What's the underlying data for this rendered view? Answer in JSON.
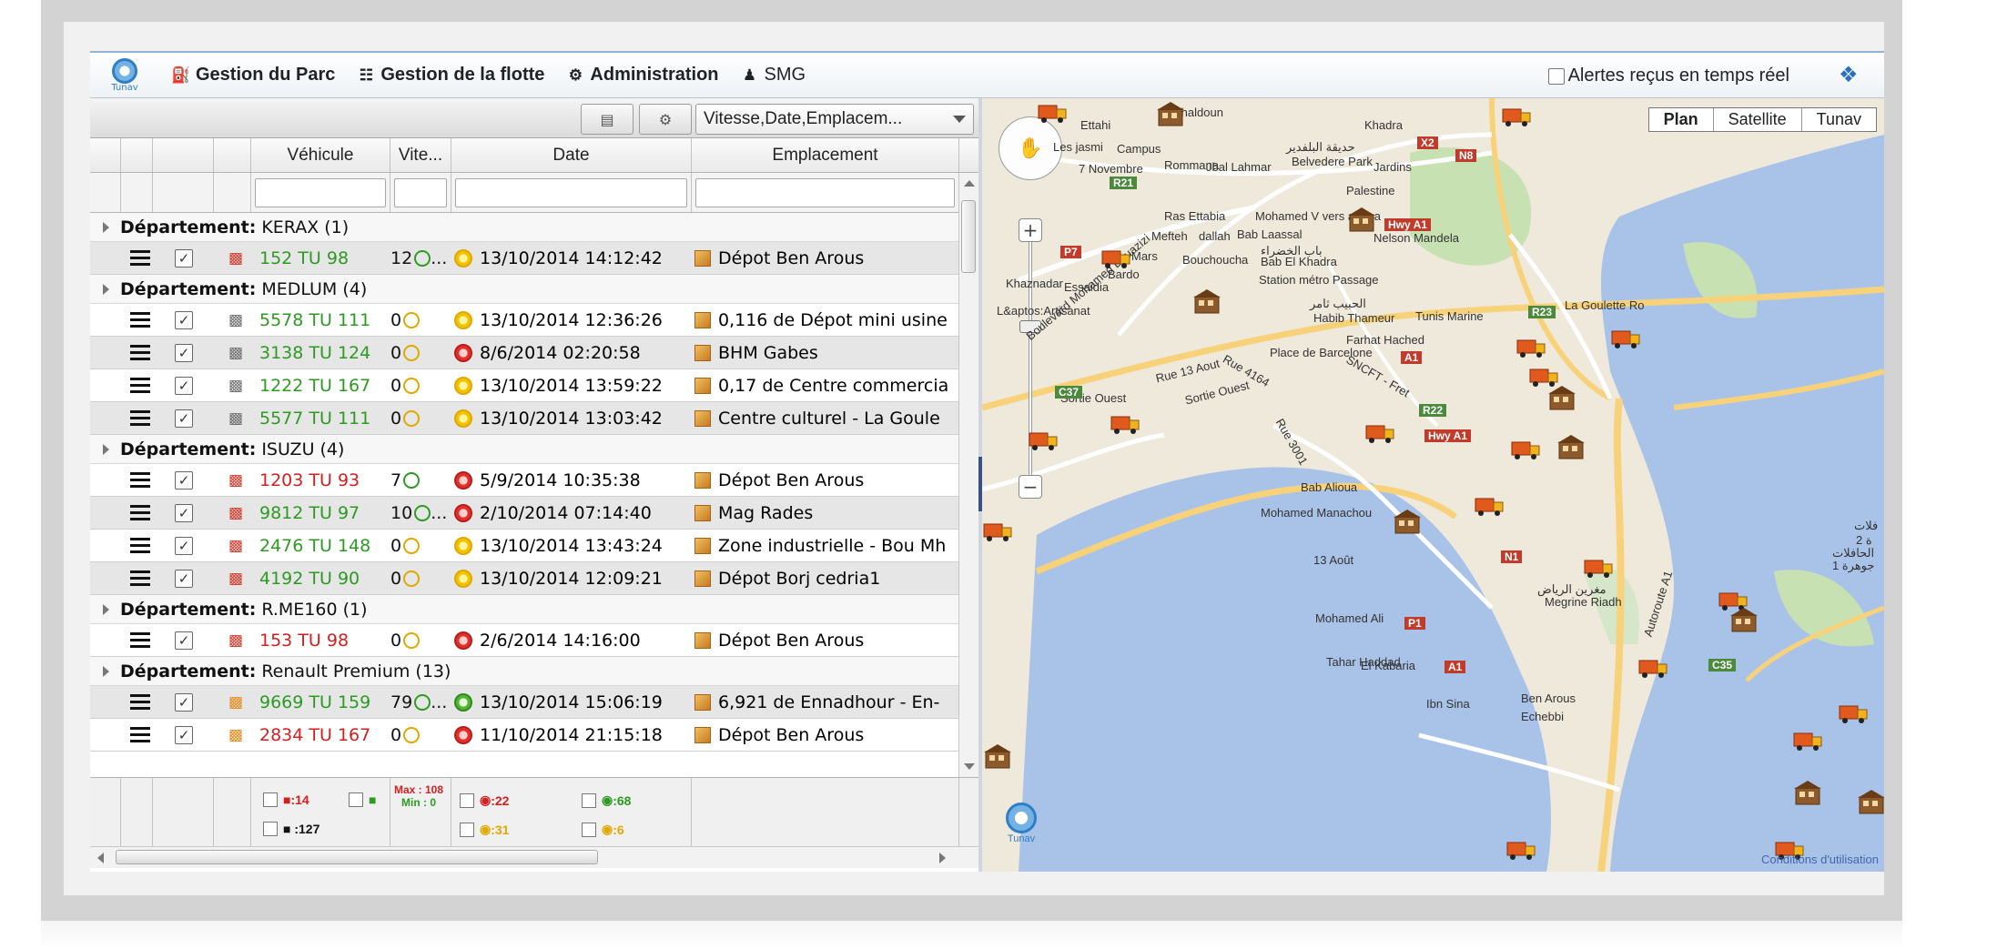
{
  "header": {
    "logo_text": "Tunav",
    "menu": [
      {
        "label": "Gestion du Parc",
        "icon": "car-icon"
      },
      {
        "label": "Gestion de la flotte",
        "icon": "fleet-icon"
      },
      {
        "label": "Administration",
        "icon": "admin-icon"
      },
      {
        "label": "SMG",
        "icon": "user-icon"
      }
    ],
    "alerts_label": "Alertes reçus en temps réel",
    "alerts_checked": false
  },
  "toolbar": {
    "columns_select_value": "Vitesse,Date,Emplacem..."
  },
  "grid": {
    "columns": [
      "Véhicule",
      "Vite...",
      "Date",
      "Emplacement"
    ],
    "groups": [
      {
        "label": "Département:",
        "name": "KERAX (1)",
        "rows": [
          {
            "vehicle": "152 TU 98",
            "vehicle_color": "green",
            "speed": "12",
            "speed_more": "...",
            "speed_state": "green",
            "date": "13/10/2014 14:12:42",
            "clock": "yellow",
            "location": "Dépot Ben Arous",
            "icon": "truck-red-icon"
          }
        ]
      },
      {
        "label": "Département:",
        "name": "MEDLUM (4)",
        "rows": [
          {
            "vehicle": "5578 TU 111",
            "vehicle_color": "green",
            "speed": "0",
            "speed_more": "",
            "speed_state": "yellow",
            "date": "13/10/2014 12:36:26",
            "clock": "yellow",
            "location": "0,116 de Dépot mini usine",
            "icon": "truck-gray-icon"
          },
          {
            "vehicle": "3138 TU 124",
            "vehicle_color": "green",
            "speed": "0",
            "speed_more": "",
            "speed_state": "yellow",
            "date": "8/6/2014 02:20:58",
            "clock": "red",
            "location": "BHM Gabes",
            "icon": "truck-gray-icon"
          },
          {
            "vehicle": "1222 TU 167",
            "vehicle_color": "green",
            "speed": "0",
            "speed_more": "",
            "speed_state": "yellow",
            "date": "13/10/2014 13:59:22",
            "clock": "yellow",
            "location": "0,17 de Centre commercia",
            "icon": "truck-gray-icon"
          },
          {
            "vehicle": "5577 TU 111",
            "vehicle_color": "green",
            "speed": "0",
            "speed_more": "",
            "speed_state": "yellow",
            "date": "13/10/2014 13:03:42",
            "clock": "yellow",
            "location": "Centre culturel - La Goule",
            "icon": "truck-gray-icon"
          }
        ]
      },
      {
        "label": "Département:",
        "name": "ISUZU (4)",
        "rows": [
          {
            "vehicle": "1203 TU 93",
            "vehicle_color": "red",
            "speed": "7",
            "speed_more": "",
            "speed_state": "green",
            "date": "5/9/2014 10:35:38",
            "clock": "red",
            "location": "Dépot Ben Arous",
            "icon": "truck-red-icon"
          },
          {
            "vehicle": "9812 TU 97",
            "vehicle_color": "green",
            "speed": "10",
            "speed_more": "...",
            "speed_state": "green",
            "date": "2/10/2014 07:14:40",
            "clock": "red",
            "location": "Mag Rades",
            "icon": "truck-red-icon"
          },
          {
            "vehicle": "2476 TU 148",
            "vehicle_color": "green",
            "speed": "0",
            "speed_more": "",
            "speed_state": "yellow",
            "date": "13/10/2014 13:43:24",
            "clock": "yellow",
            "location": "Zone industrielle - Bou Mh",
            "icon": "truck-red-icon"
          },
          {
            "vehicle": "4192 TU 90",
            "vehicle_color": "green",
            "speed": "0",
            "speed_more": "",
            "speed_state": "yellow",
            "date": "13/10/2014 12:09:21",
            "clock": "yellow",
            "location": "Dépot Borj cedria1",
            "icon": "truck-red-icon"
          }
        ]
      },
      {
        "label": "Département:",
        "name": "R.ME160 (1)",
        "rows": [
          {
            "vehicle": "153 TU 98",
            "vehicle_color": "red",
            "speed": "0",
            "speed_more": "",
            "speed_state": "yellow",
            "date": "2/6/2014 14:16:00",
            "clock": "red",
            "location": "Dépot Ben Arous",
            "icon": "truck-red-icon"
          }
        ]
      },
      {
        "label": "Département:",
        "name": "Renault Premium (13)",
        "rows": [
          {
            "vehicle": "9669 TU 159",
            "vehicle_color": "green",
            "speed": "79",
            "speed_more": "...",
            "speed_state": "green",
            "date": "13/10/2014 15:06:19",
            "clock": "green",
            "location": "6,921 de Ennadhour - En-",
            "icon": "truck-orange-icon"
          },
          {
            "vehicle": "2834 TU 167",
            "vehicle_color": "red",
            "speed": "0",
            "speed_more": "",
            "speed_state": "yellow",
            "date": "11/10/2014 21:15:18",
            "clock": "red",
            "location": "Dépot Ben Arous",
            "icon": "truck-orange-icon"
          }
        ]
      }
    ],
    "footer": {
      "red_count": ":14",
      "total_count": ":127",
      "max": "Max : 108",
      "min": "Min : 0",
      "clock_red": ":22",
      "clock_yellow": ":31",
      "clock_green": ":68",
      "clock_yellow2": ":6"
    }
  },
  "map": {
    "types": [
      "Plan",
      "Satellite",
      "Tunav"
    ],
    "active_type": "Plan",
    "terms": "Conditions d'utilisation",
    "logo_text": "Tunav",
    "labels": [
      "Khaldoun",
      "Ettahi",
      "Campus",
      "Les jasmi",
      "Rommana",
      "Jbal Lahmar",
      "7 Novembre",
      "حديقة البلفدير",
      "Belvedere Park",
      "Jardins",
      "Khadra",
      "Palestine",
      "Ras Ettabia",
      "Mefteh",
      "dallah",
      "Bab Laassal",
      "Mohamed V vers ariana",
      "Nelson Mandela",
      "باب الخضراء",
      "Bab El Khadra",
      "Mars",
      "Bouchoucha",
      "Bardo",
      "Essaidia",
      "Station métro Passage",
      "Khaznadar",
      "L&aptos:Artisanat",
      "الحبيب ثامر",
      "Habib Thameur",
      "Tunis Marine",
      "La Goulette Ro",
      "Farhat Hached",
      "Place de Barcelone",
      "Rue 13 Aout",
      "Rue 4164",
      "Sortie Ouest",
      "Sortie Ouest",
      "SNCFT - Fret",
      "Rue 3001",
      "Bab Alioua",
      "Mohamed Manachou",
      "13 Août",
      "Mohamed Ali",
      "Tahar Haddad",
      "El Kabaria",
      "Ibn Sina",
      "Ben Arous",
      "Echebbi",
      "مغرين الرياض",
      "Megrine Riadh",
      "Autoroute A1",
      "Boulevard Mohamed Bouazizi",
      "الحافلات",
      "جوهرة 1",
      "2 ة",
      "فلات"
    ],
    "road_badges": [
      "R21",
      "P7",
      "X2",
      "N8",
      "Hwy A1",
      "R23",
      "A1",
      "R22",
      "Hwy A1",
      "C37",
      "N1",
      "P1",
      "A1",
      "C35"
    ]
  }
}
